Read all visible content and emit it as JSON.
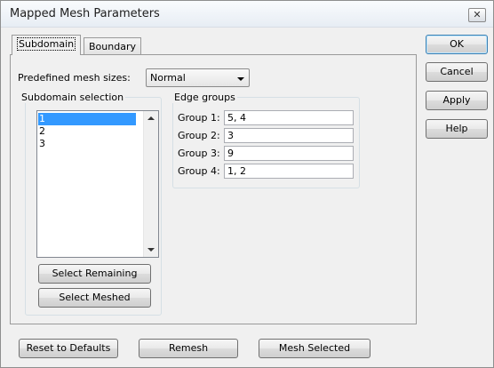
{
  "window": {
    "title": "Mapped Mesh Parameters",
    "close_glyph": "✕"
  },
  "tabs": [
    {
      "label": "Subdomain",
      "active": true
    },
    {
      "label": "Boundary",
      "active": false
    }
  ],
  "predefined": {
    "label": "Predefined mesh sizes:",
    "value": "Normal"
  },
  "subdomain_selection": {
    "title": "Subdomain selection",
    "items": [
      "1",
      "2",
      "3"
    ],
    "selected_index": 0,
    "select_remaining_label": "Select Remaining",
    "select_meshed_label": "Select Meshed"
  },
  "edge_groups": {
    "title": "Edge groups",
    "groups": [
      {
        "label": "Group 1:",
        "value": "5, 4"
      },
      {
        "label": "Group 2:",
        "value": "3"
      },
      {
        "label": "Group 3:",
        "value": "9"
      },
      {
        "label": "Group 4:",
        "value": "1, 2"
      }
    ]
  },
  "side_buttons": {
    "ok": "OK",
    "cancel": "Cancel",
    "apply": "Apply",
    "help": "Help"
  },
  "bottom_buttons": {
    "reset": "Reset to Defaults",
    "remesh": "Remesh",
    "mesh_selected": "Mesh Selected"
  }
}
